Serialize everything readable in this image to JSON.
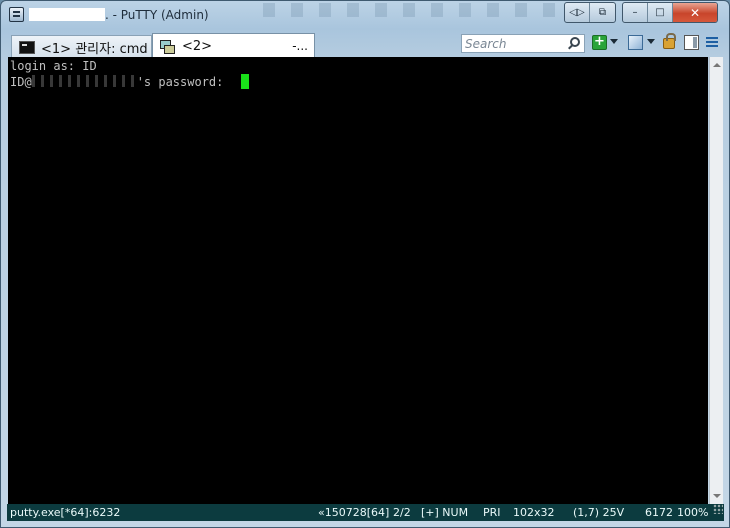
{
  "window": {
    "title": ". - PuTTY (Admin)",
    "controls": {
      "restore_alt": "◁▷",
      "maximize_alt": "⧉",
      "minimize": "–",
      "maximize": "□",
      "close": "✕"
    }
  },
  "tabs": [
    {
      "label": "<1> 관리자: cmd",
      "icon": "cmd-icon"
    },
    {
      "label": "<2>",
      "icon": "putty-icon",
      "suffix": "-..."
    }
  ],
  "search": {
    "placeholder": "Search"
  },
  "toolbar_icons": [
    "add-console-icon",
    "dropdown-icon",
    "view-icon",
    "dropdown-icon",
    "lock-icon",
    "panel-icon",
    "menu-icon"
  ],
  "terminal": {
    "line1": "login as: ID",
    "line2_prefix": "ID@",
    "line2_suffix": "'s password: ",
    "cursor_color": "#19e019"
  },
  "status": {
    "process": "putty.exe[*64]:6232",
    "build": "«150728[64]",
    "console": "2/2",
    "flags": "[+] NUM",
    "priority": "PRI",
    "size": "102x32",
    "cursor": "(1,7) 25V",
    "pid": "6172",
    "zoom": "100%"
  },
  "colors": {
    "status_bg": "#0c3b3f",
    "terminal_bg": "#000000",
    "close_button": "#c8452b"
  }
}
